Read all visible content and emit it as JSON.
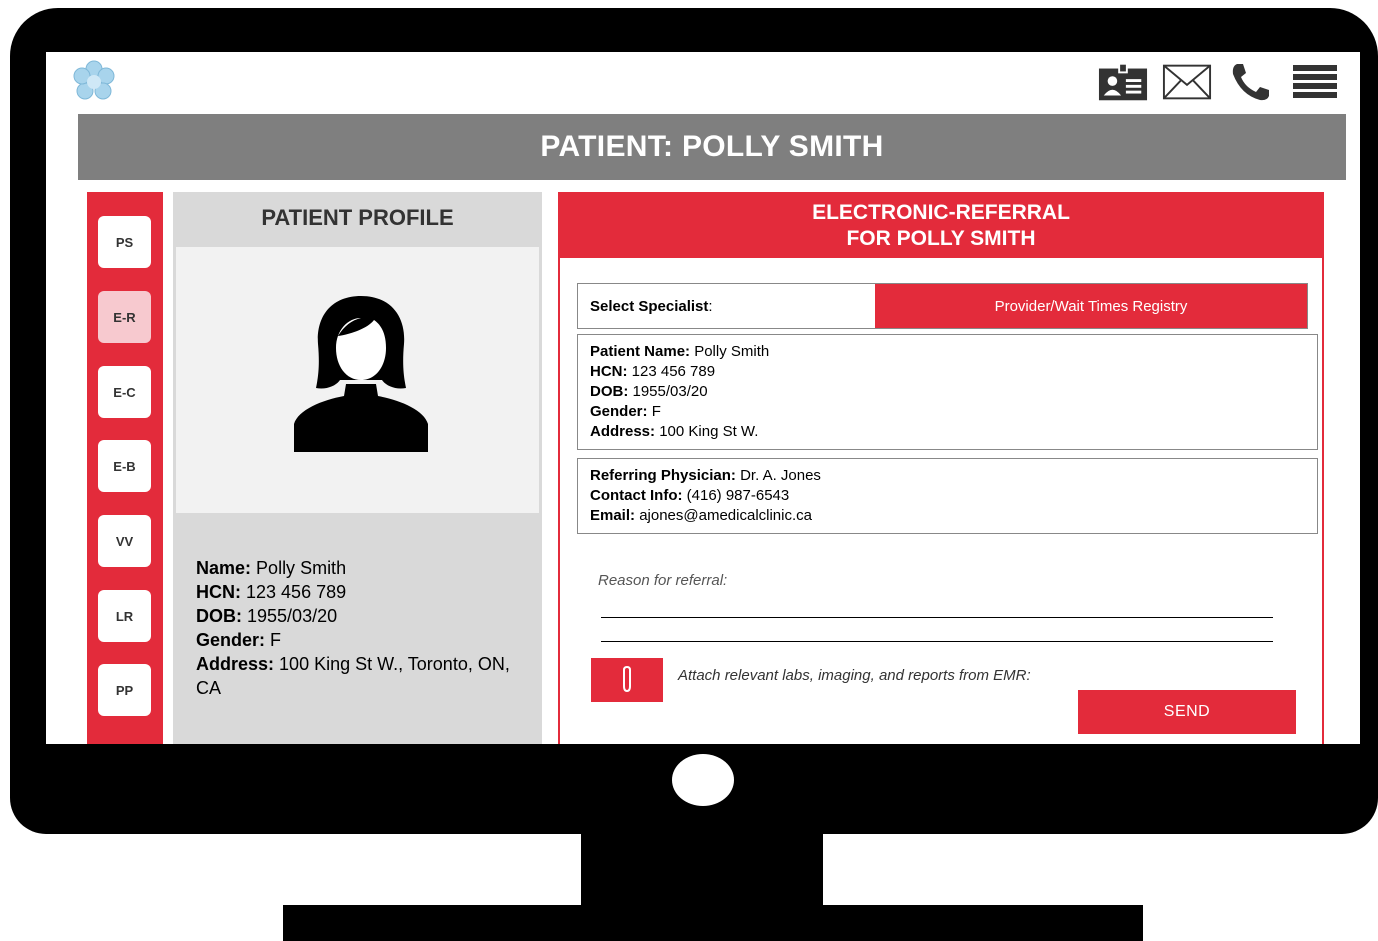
{
  "header": {
    "title": "PATIENT: POLLY SMITH",
    "icons": [
      "contact-card-icon",
      "mail-icon",
      "phone-icon",
      "menu-icon"
    ]
  },
  "nav": {
    "items": [
      {
        "label": "PS",
        "active": false
      },
      {
        "label": "E-R",
        "active": true
      },
      {
        "label": "E-C",
        "active": false
      },
      {
        "label": "E-B",
        "active": false
      },
      {
        "label": "VV",
        "active": false
      },
      {
        "label": "LR",
        "active": false
      },
      {
        "label": "PP",
        "active": false
      }
    ]
  },
  "profile": {
    "title": "PATIENT PROFILE",
    "name_label": "Name:",
    "name": "Polly Smith",
    "hcn_label": "HCN:",
    "hcn": "123 456 789",
    "dob_label": "DOB:",
    "dob": "1955/03/20",
    "gender_label": "Gender:",
    "gender": "F",
    "address_label": "Address:",
    "address": "100 King St W., Toronto, ON, CA"
  },
  "referral": {
    "title_line1": "ELECTRONIC-REFERRAL",
    "title_line2": "FOR POLLY SMITH",
    "select_specialist_label": "Select Specialist",
    "select_specialist_colon": ":",
    "registry_button": "Provider/Wait Times Registry",
    "patient": {
      "name_label": "Patient Name:",
      "name": "Polly Smith",
      "hcn_label": "HCN:",
      "hcn": "123 456 789",
      "dob_label": "DOB:",
      "dob": "1955/03/20",
      "gender_label": "Gender:",
      "gender": "F",
      "address_label": "Address:",
      "address": "100 King St W."
    },
    "physician": {
      "name_label": "Referring Physician:",
      "name": "Dr. A. Jones",
      "contact_label": "Contact Info:",
      "contact": "(416) 987-6543",
      "email_label": "Email:",
      "email": "ajones@amedicalclinic.ca"
    },
    "reason_label": "Reason for referral:",
    "attach_label": "Attach relevant labs, imaging, and reports from EMR:",
    "send_button": "SEND"
  },
  "colors": {
    "accent": "#e32b3b",
    "title_bar": "#7f7f7f",
    "panel": "#d9d9d9",
    "active_nav": "#f7c9cf",
    "logo": "#a8d4ec"
  }
}
